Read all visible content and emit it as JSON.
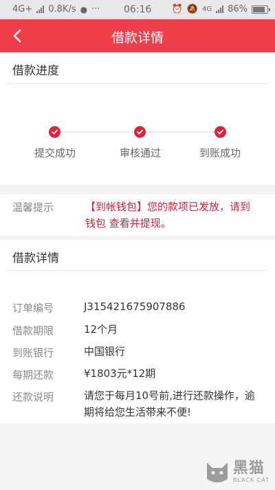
{
  "status_bar": {
    "network": "4G+",
    "speed": "0.8K/s",
    "time": "06:16",
    "network_right": "4G",
    "battery": "86%",
    "battery_level": 0.86
  },
  "nav": {
    "title": "借款详情",
    "back_icon": "chevron-left-icon"
  },
  "progress": {
    "title": "借款进度",
    "steps": [
      {
        "label": "提交成功",
        "status": "done"
      },
      {
        "label": "审核通过",
        "status": "done"
      },
      {
        "label": "到账成功",
        "status": "done"
      }
    ]
  },
  "notice": {
    "label": "温馨提示",
    "text": "【到帐钱包】您的款项已发放，请到 钱包 查看并提现。"
  },
  "details": {
    "title": "借款详情",
    "rows": [
      {
        "label": "订单编号",
        "value": "J315421675907886"
      },
      {
        "label": "借款期限",
        "value": "12个月"
      },
      {
        "label": "到账银行",
        "value": "中国银行"
      },
      {
        "label": "每期还款",
        "value": "¥1803元*12期"
      },
      {
        "label": "还款说明",
        "value": "请您于每月10号前,进行还款操作，逾期将给您生活带来不便!"
      }
    ]
  },
  "watermark": {
    "text_cn": "黑猫",
    "text_en": "BLACK CAT"
  },
  "colors": {
    "brand_red": "#ef3e4a",
    "step_red": "#e5213a",
    "notice_red": "#d3213b"
  }
}
